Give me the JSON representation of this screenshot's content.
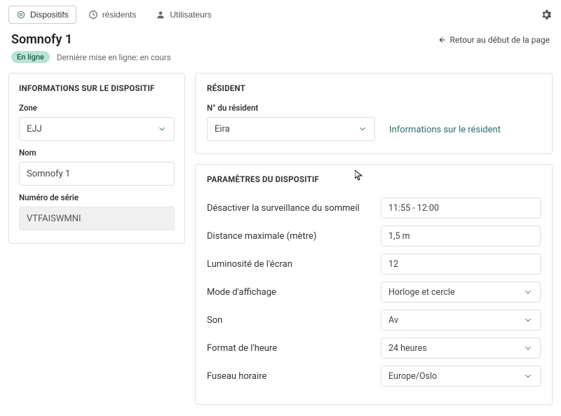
{
  "tabs": {
    "devices": "Dispositifs",
    "residents": "résidents",
    "users": "Utilisateurs"
  },
  "page": {
    "title": "Somnofy 1",
    "back_link": "Retour au début de la page",
    "status_badge": "En ligne",
    "status_text": "Dernière mise en ligne: en cours"
  },
  "device_info": {
    "heading": "INFORMATIONS SUR LE DISPOSITIF",
    "zone_label": "Zone",
    "zone_value": "EJJ",
    "name_label": "Nom",
    "name_value": "Somnofy 1",
    "serial_label": "Numéro de série",
    "serial_value": "VTFAISWMNI"
  },
  "resident": {
    "heading": "RÉSIDENT",
    "number_label": "N° du résident",
    "number_value": "Eira",
    "info_link": "Informations sur le résident"
  },
  "settings": {
    "heading": "PARAMÈTRES DU DISPOSITIF",
    "rows": [
      {
        "label": "Désactiver la surveillance du sommeil",
        "value": "11:55 - 12:00",
        "kind": "text"
      },
      {
        "label": "Distance maximale (mètre)",
        "value": "1,5 m",
        "kind": "text"
      },
      {
        "label": "Luminosité de l'écran",
        "value": "12",
        "kind": "text"
      },
      {
        "label": "Mode d'affichage",
        "value": "Horloge et cercle",
        "kind": "select"
      },
      {
        "label": "Son",
        "value": "Av",
        "kind": "select"
      },
      {
        "label": "Format de l'heure",
        "value": "24 heures",
        "kind": "select"
      },
      {
        "label": "Fuseau horaire",
        "value": "Europe/Oslo",
        "kind": "select"
      }
    ]
  },
  "colors": {
    "accent": "#2b6e66",
    "badge_bg": "#b7e4d4"
  }
}
